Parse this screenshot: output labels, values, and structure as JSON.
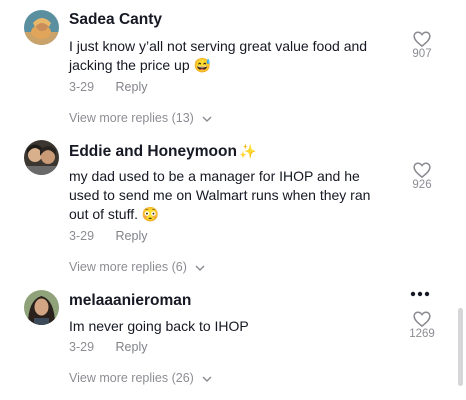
{
  "comments": [
    {
      "username": "Sadea Canty",
      "text": "I just know y’all not serving great value food and jacking the price up",
      "emoji": "😅",
      "date": "3-29",
      "reply_label": "Reply",
      "likes": "907",
      "view_more": "View more replies (13)",
      "avatar_icon": "avatar-photo"
    },
    {
      "username": "Eddie and Honeymoon",
      "username_suffix": "✨",
      "text": "my dad used to be a manager for IHOP and he used to send me on Walmart runs when they ran out of stuff.",
      "emoji": "😳",
      "date": "3-29",
      "reply_label": "Reply",
      "likes": "926",
      "view_more": "View more replies (6)",
      "avatar_icon": "avatar-photo"
    },
    {
      "username": "melaaanieroman",
      "text": "Im never going back to IHOP",
      "date": "3-29",
      "reply_label": "Reply",
      "likes": "1269",
      "view_more": "View more replies (26)",
      "avatar_icon": "avatar-photo"
    }
  ],
  "more_options_icon": "more-horizontal-icon",
  "like_icon": "heart-outline-icon",
  "colors": {
    "text_primary": "#161823",
    "text_secondary": "#8a8b91",
    "background": "#ffffff"
  }
}
